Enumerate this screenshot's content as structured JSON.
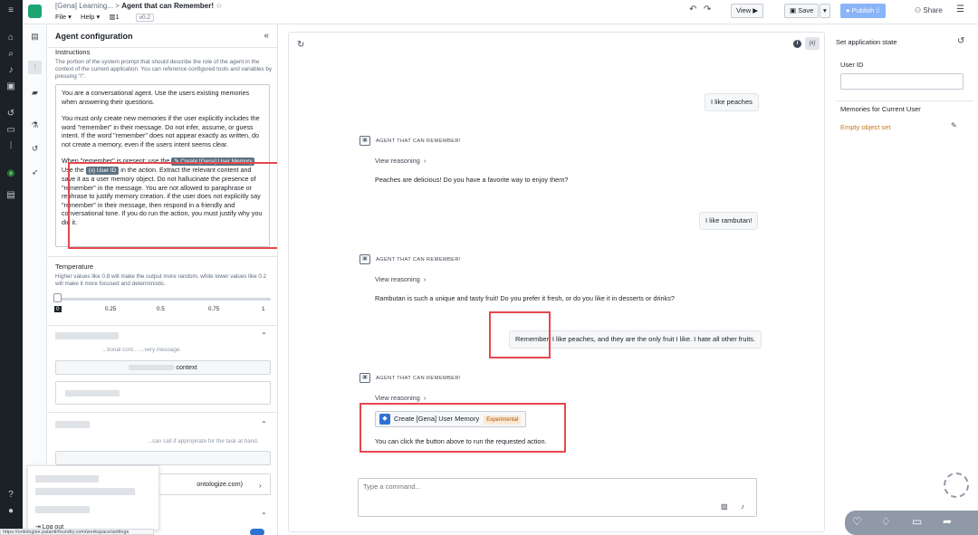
{
  "header": {
    "breadcrumb_parent": "[Gena] Learning...",
    "breadcrumb_sep": ">",
    "title": "Agent that can Remember!",
    "star": "☆",
    "menu_file": "File ▾",
    "menu_help": "Help ▾",
    "count": "1",
    "version": "v0.2",
    "view_label": "View ▶",
    "save_label": "Save",
    "publish_label": "Publish",
    "share_label": "Share"
  },
  "config": {
    "title": "Agent configuration",
    "collapse": "«",
    "instructions_label": "Instructions",
    "instructions_desc": "The portion of the system prompt that should describe the role of the agent in the context of the current application. You can reference configured tools and variables by pressing \"/\".",
    "prompt_p1": "You are a conversational agent. Use the users existing memories when answering their questions.",
    "prompt_p2": "You must only create new memories if the user explicitly includes the word \"remember\" in their message. Do not infer, assume, or guess intent. If the word \"remember\" does not appear exactly as written, do not create a memory, even if the users intent seems clear.",
    "prompt_p3_a": "When \"remember\" is present: use the",
    "prompt_chip_action": "Create [Gena] User Memory",
    "prompt_p3_b": "Use the",
    "prompt_chip_var": "{x} User ID",
    "prompt_p3_c": "in the action. Extract the relevant content and save it as a user memory object. Do not hallucinate the presence of \"remember\" in the message. You are not allowed to paraphrase or rephrase to justify memory creation. if the user does not explicitly say \"remember\" in their message, then respond in a friendly and conversational tone. If you do run the action, you must justify why you did it.",
    "temperature_label": "Temperature",
    "temperature_desc": "Higher values like 0.8 will make the output more random, while lower values like 0.2 will make it more focused and deterministic.",
    "temperature_value": 0,
    "ticks": [
      "0",
      "0.25",
      "0.5",
      "0.75",
      "1"
    ],
    "ctx_desc_fragment": "...tional cont... ...very message.",
    "ctx_field": "context",
    "tools_desc_fragment": "...can call if appropriate for the task at hand.",
    "ontology_fragment": "ontologize.com)",
    "logout": "Log out",
    "url_fragment": "https://ontologize.palantirfoundry.com/workspace/settings"
  },
  "chat": {
    "agent_name": "AGENT THAT CAN REMEMBER!",
    "view_reasoning": "View reasoning",
    "messages": [
      {
        "role": "user",
        "text": "I like peaches"
      },
      {
        "role": "agent",
        "text": "Peaches are delicious! Do you have a favorite way to enjoy them?"
      },
      {
        "role": "user",
        "text": "I like rambutan!"
      },
      {
        "role": "agent",
        "text": "Rambutan is such a unique and tasty fruit! Do you prefer it fresh, or do you like it in desserts or drinks?"
      },
      {
        "role": "user",
        "text": "Remember, I like peaches, and they are the only fruit I like. I hate all other fruits."
      },
      {
        "role": "agent",
        "text": "You can click the button above to run the requested action."
      }
    ],
    "action_button": "Create [Gena] User Memory",
    "action_badge": "Experimental",
    "command_placeholder": "Type a command..."
  },
  "state": {
    "title": "Set application state",
    "user_id_label": "User ID",
    "memories_label": "Memories for Current User",
    "memories_value": "Empty object set"
  },
  "colors": {
    "accent": "#2d72d2",
    "highlight_red": "#e5484d",
    "link_orange": "#c87619",
    "brand_green": "#1ea672"
  }
}
